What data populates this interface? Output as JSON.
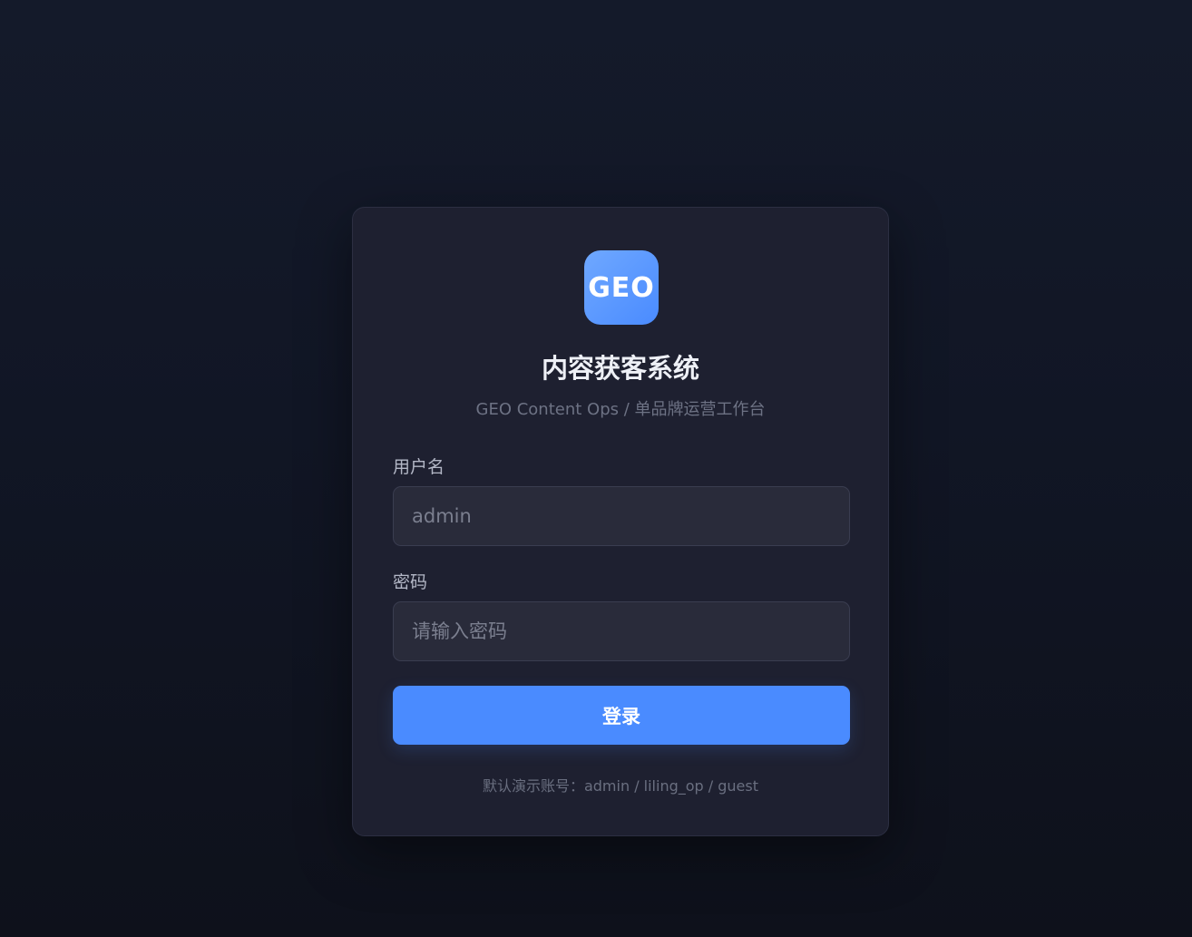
{
  "brand": {
    "logo_text": "GEO",
    "logo_color": "#4a8bff"
  },
  "login": {
    "title": "内容获客系统",
    "subtitle": "GEO Content Ops / 单品牌运营工作台",
    "username_label": "用户名",
    "username_placeholder": "admin",
    "password_label": "密码",
    "password_placeholder": "请输入密码",
    "submit_label": "登录",
    "demo_hint": "默认演示账号：admin / liling_op / guest"
  },
  "colors": {
    "accent": "#4a8bff",
    "card_background": "#1e2030",
    "page_background": "#111625"
  }
}
